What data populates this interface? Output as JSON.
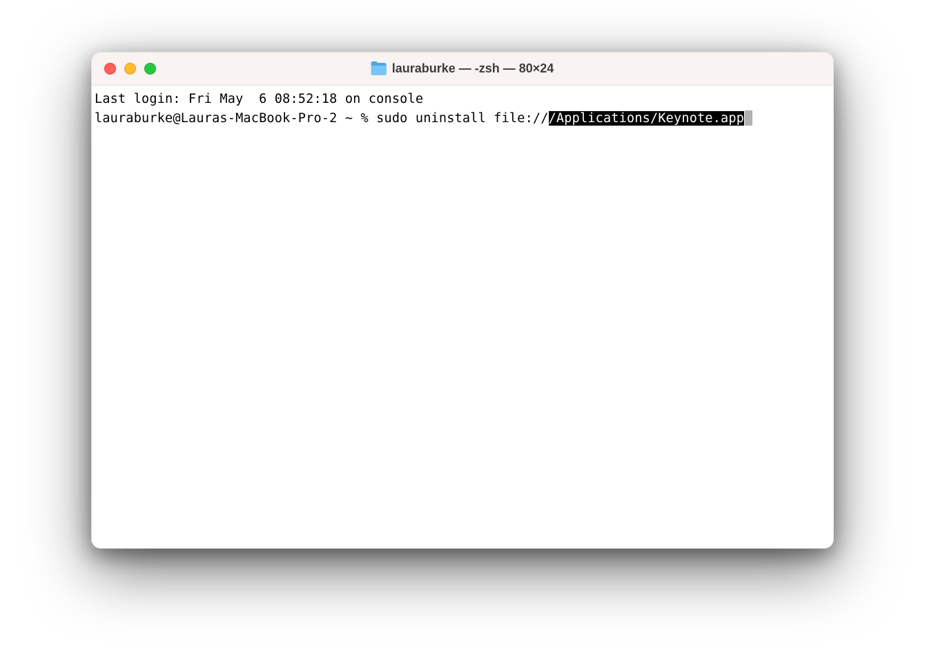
{
  "titlebar": {
    "title": "lauraburke — -zsh — 80×24",
    "icon": "home-folder-icon"
  },
  "traffic_lights": {
    "close": "close",
    "minimize": "minimize",
    "zoom": "zoom"
  },
  "terminal": {
    "last_login_line": "Last login: Fri May  6 08:52:18 on console",
    "prompt": "lauraburke@Lauras-MacBook-Pro-2 ~ % ",
    "command_plain": "sudo uninstall file://",
    "command_selected": "/Applications/Keynote.app"
  }
}
